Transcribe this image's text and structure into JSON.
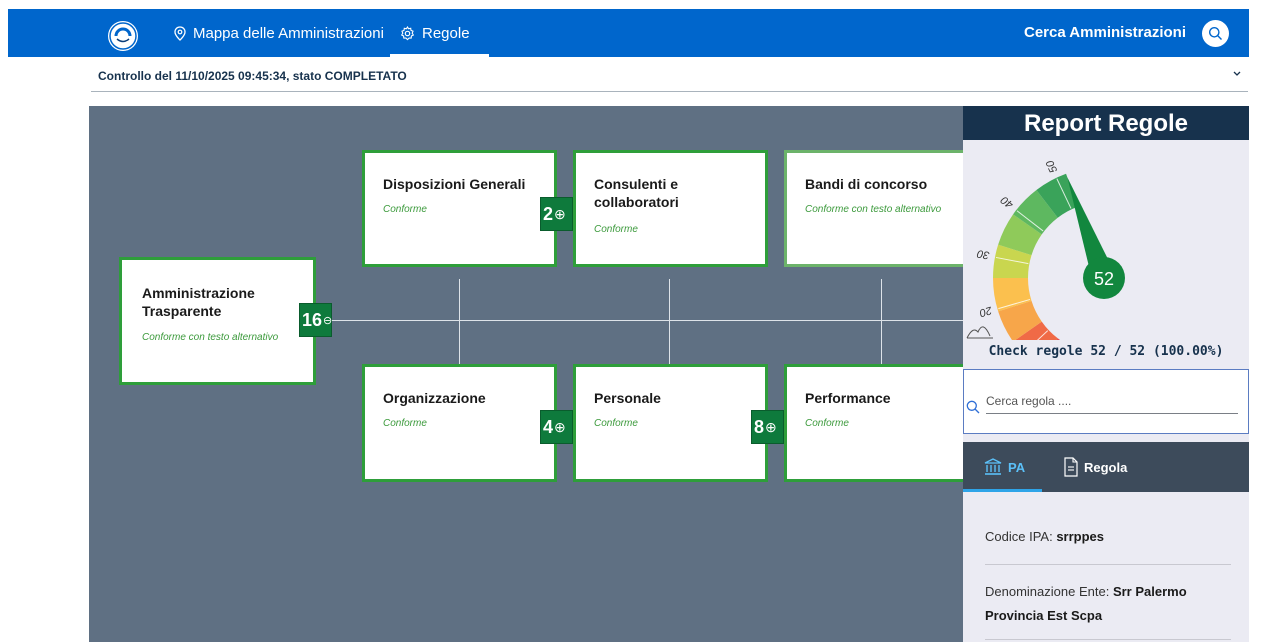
{
  "nav": {
    "map_label": "Mappa delle Amministrazioni",
    "rules_label": "Regole",
    "search_label": "Cerca Amministrazioni"
  },
  "control": {
    "text": "Controllo del 11/10/2025 09:45:34, stato COMPLETATO"
  },
  "tree": {
    "root": {
      "title": "Amministrazione Trasparente",
      "status": "Conforme con testo alternativo",
      "count": "16"
    },
    "children": [
      {
        "title": "Disposizioni Generali",
        "status": "Conforme",
        "count": "2"
      },
      {
        "title": "Consulenti e collaboratori",
        "status": "Conforme"
      },
      {
        "title": "Bandi di concorso",
        "status": "Conforme con testo alternativo"
      },
      {
        "title": "Organizzazione",
        "status": "Conforme",
        "count": "4"
      },
      {
        "title": "Personale",
        "status": "Conforme",
        "count": "8"
      },
      {
        "title": "Performance",
        "status": "Conforme"
      }
    ]
  },
  "report": {
    "title": "Report Regole",
    "gauge": {
      "value": 52,
      "value_label": "52",
      "min": 0,
      "max": 52,
      "ticks": [
        "0",
        "10",
        "20",
        "30",
        "40",
        "50"
      ]
    },
    "check_text": "Check regole 52 / 52 (100.00%)"
  },
  "search": {
    "placeholder": "Cerca regola ...."
  },
  "tabs": {
    "pa": "PA",
    "regola": "Regola"
  },
  "info": {
    "codice_label": "Codice IPA:",
    "codice_value": "srrppes",
    "denominazione_label": "Denominazione Ente:",
    "denominazione_value": "Srr Palermo Provincia Est Scpa"
  },
  "colors": {
    "navbar": "#0066cc",
    "canvas": "#5f7083",
    "card_border": "#2e9e3a",
    "badge": "#0e7a3c",
    "report_header": "#17324d",
    "tabs_bg": "#3d4b5b",
    "tab_active": "#5bc0f8"
  }
}
